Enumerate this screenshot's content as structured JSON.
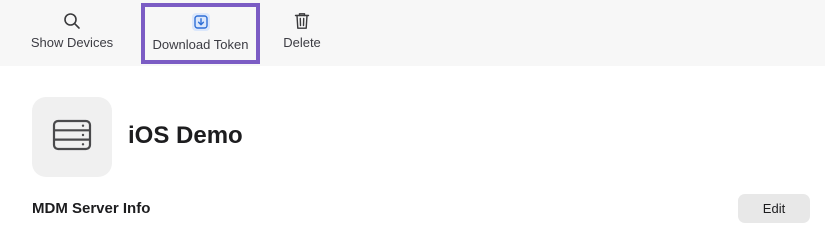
{
  "toolbar": {
    "show_devices": {
      "label": "Show Devices",
      "icon": "search-icon"
    },
    "download_token": {
      "label": "Download Token",
      "icon": "download-icon",
      "highlight_color": "#7b5cc4"
    },
    "delete": {
      "label": "Delete",
      "icon": "trash-icon"
    }
  },
  "server": {
    "icon": "server-icon",
    "title": "iOS Demo"
  },
  "section": {
    "title": "MDM Server Info",
    "edit_label": "Edit"
  }
}
